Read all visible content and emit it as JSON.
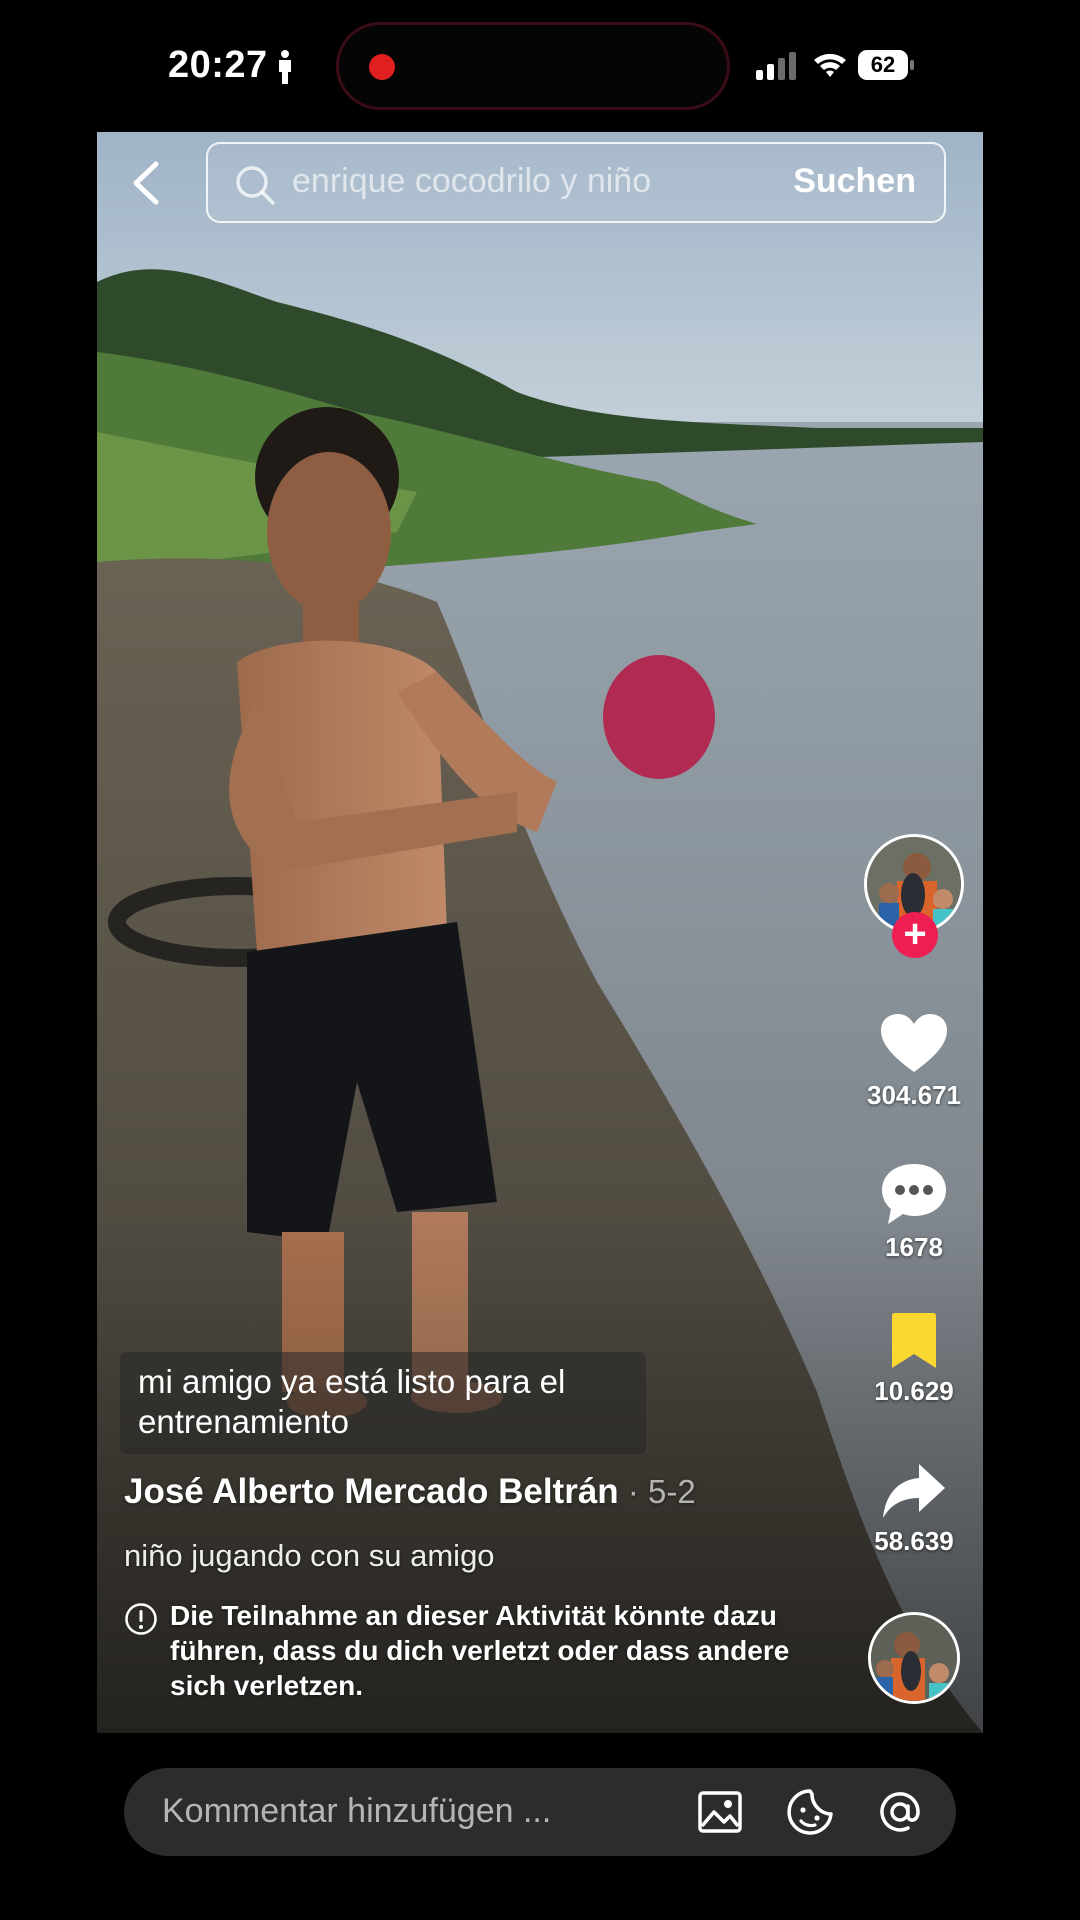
{
  "status_bar": {
    "time": "20:27",
    "battery": "62",
    "recording_color": "#e02020"
  },
  "search": {
    "placeholder": "enrique cocodrilo y niño",
    "button_label": "Suchen"
  },
  "actions": {
    "likes": "304.671",
    "comments": "1678",
    "saves": "10.629",
    "shares": "58.639",
    "follow_label": "+",
    "like_color": "#ffffff",
    "save_color": "#fbd731",
    "follow_color": "#ee1d52"
  },
  "video": {
    "caption": "mi amigo ya está listo para el entrenamiento",
    "author": "José Alberto Mercado Beltrán",
    "date": " · 5-2",
    "description": "niño jugando con su amigo",
    "warning": "Die Teilnahme an dieser Aktivität könnte dazu führen, dass du dich verletzt oder dass andere sich verletzen."
  },
  "comment_bar": {
    "placeholder": "Kommentar hinzufügen ..."
  },
  "icons": {
    "back": "chevron-left-icon",
    "search": "search-icon",
    "like": "heart-icon",
    "comment": "comment-bubble-icon",
    "save": "bookmark-icon",
    "share": "share-arrow-icon",
    "image": "image-icon",
    "emoji": "sticker-icon",
    "mention": "at-icon"
  }
}
